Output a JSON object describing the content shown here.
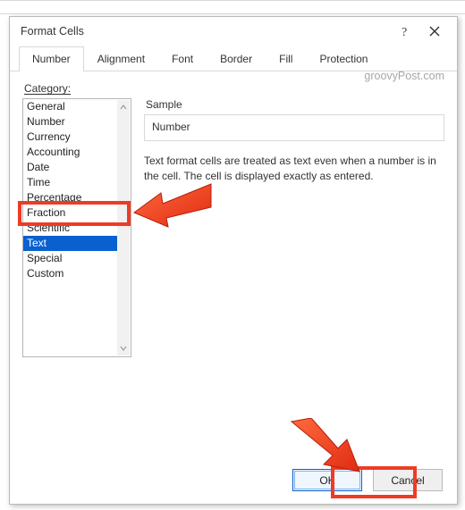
{
  "dialog": {
    "title": "Format Cells",
    "tabs": [
      "Number",
      "Alignment",
      "Font",
      "Border",
      "Fill",
      "Protection"
    ],
    "active_tab_index": 0
  },
  "category_label": "Category:",
  "categories": [
    "General",
    "Number",
    "Currency",
    "Accounting",
    "Date",
    "Time",
    "Percentage",
    "Fraction",
    "Scientific",
    "Text",
    "Special",
    "Custom"
  ],
  "selected_category_index": 9,
  "sample": {
    "label": "Sample",
    "value": "Number"
  },
  "description": "Text format cells are treated as text even when a number is in the cell. The cell is displayed exactly as entered.",
  "watermark": "groovyPost.com",
  "buttons": {
    "ok": "OK",
    "cancel": "Cancel"
  },
  "icons": {
    "help": "help-icon",
    "close": "close-icon",
    "scroll_up": "chevron-up-icon",
    "scroll_down": "chevron-down-icon"
  }
}
